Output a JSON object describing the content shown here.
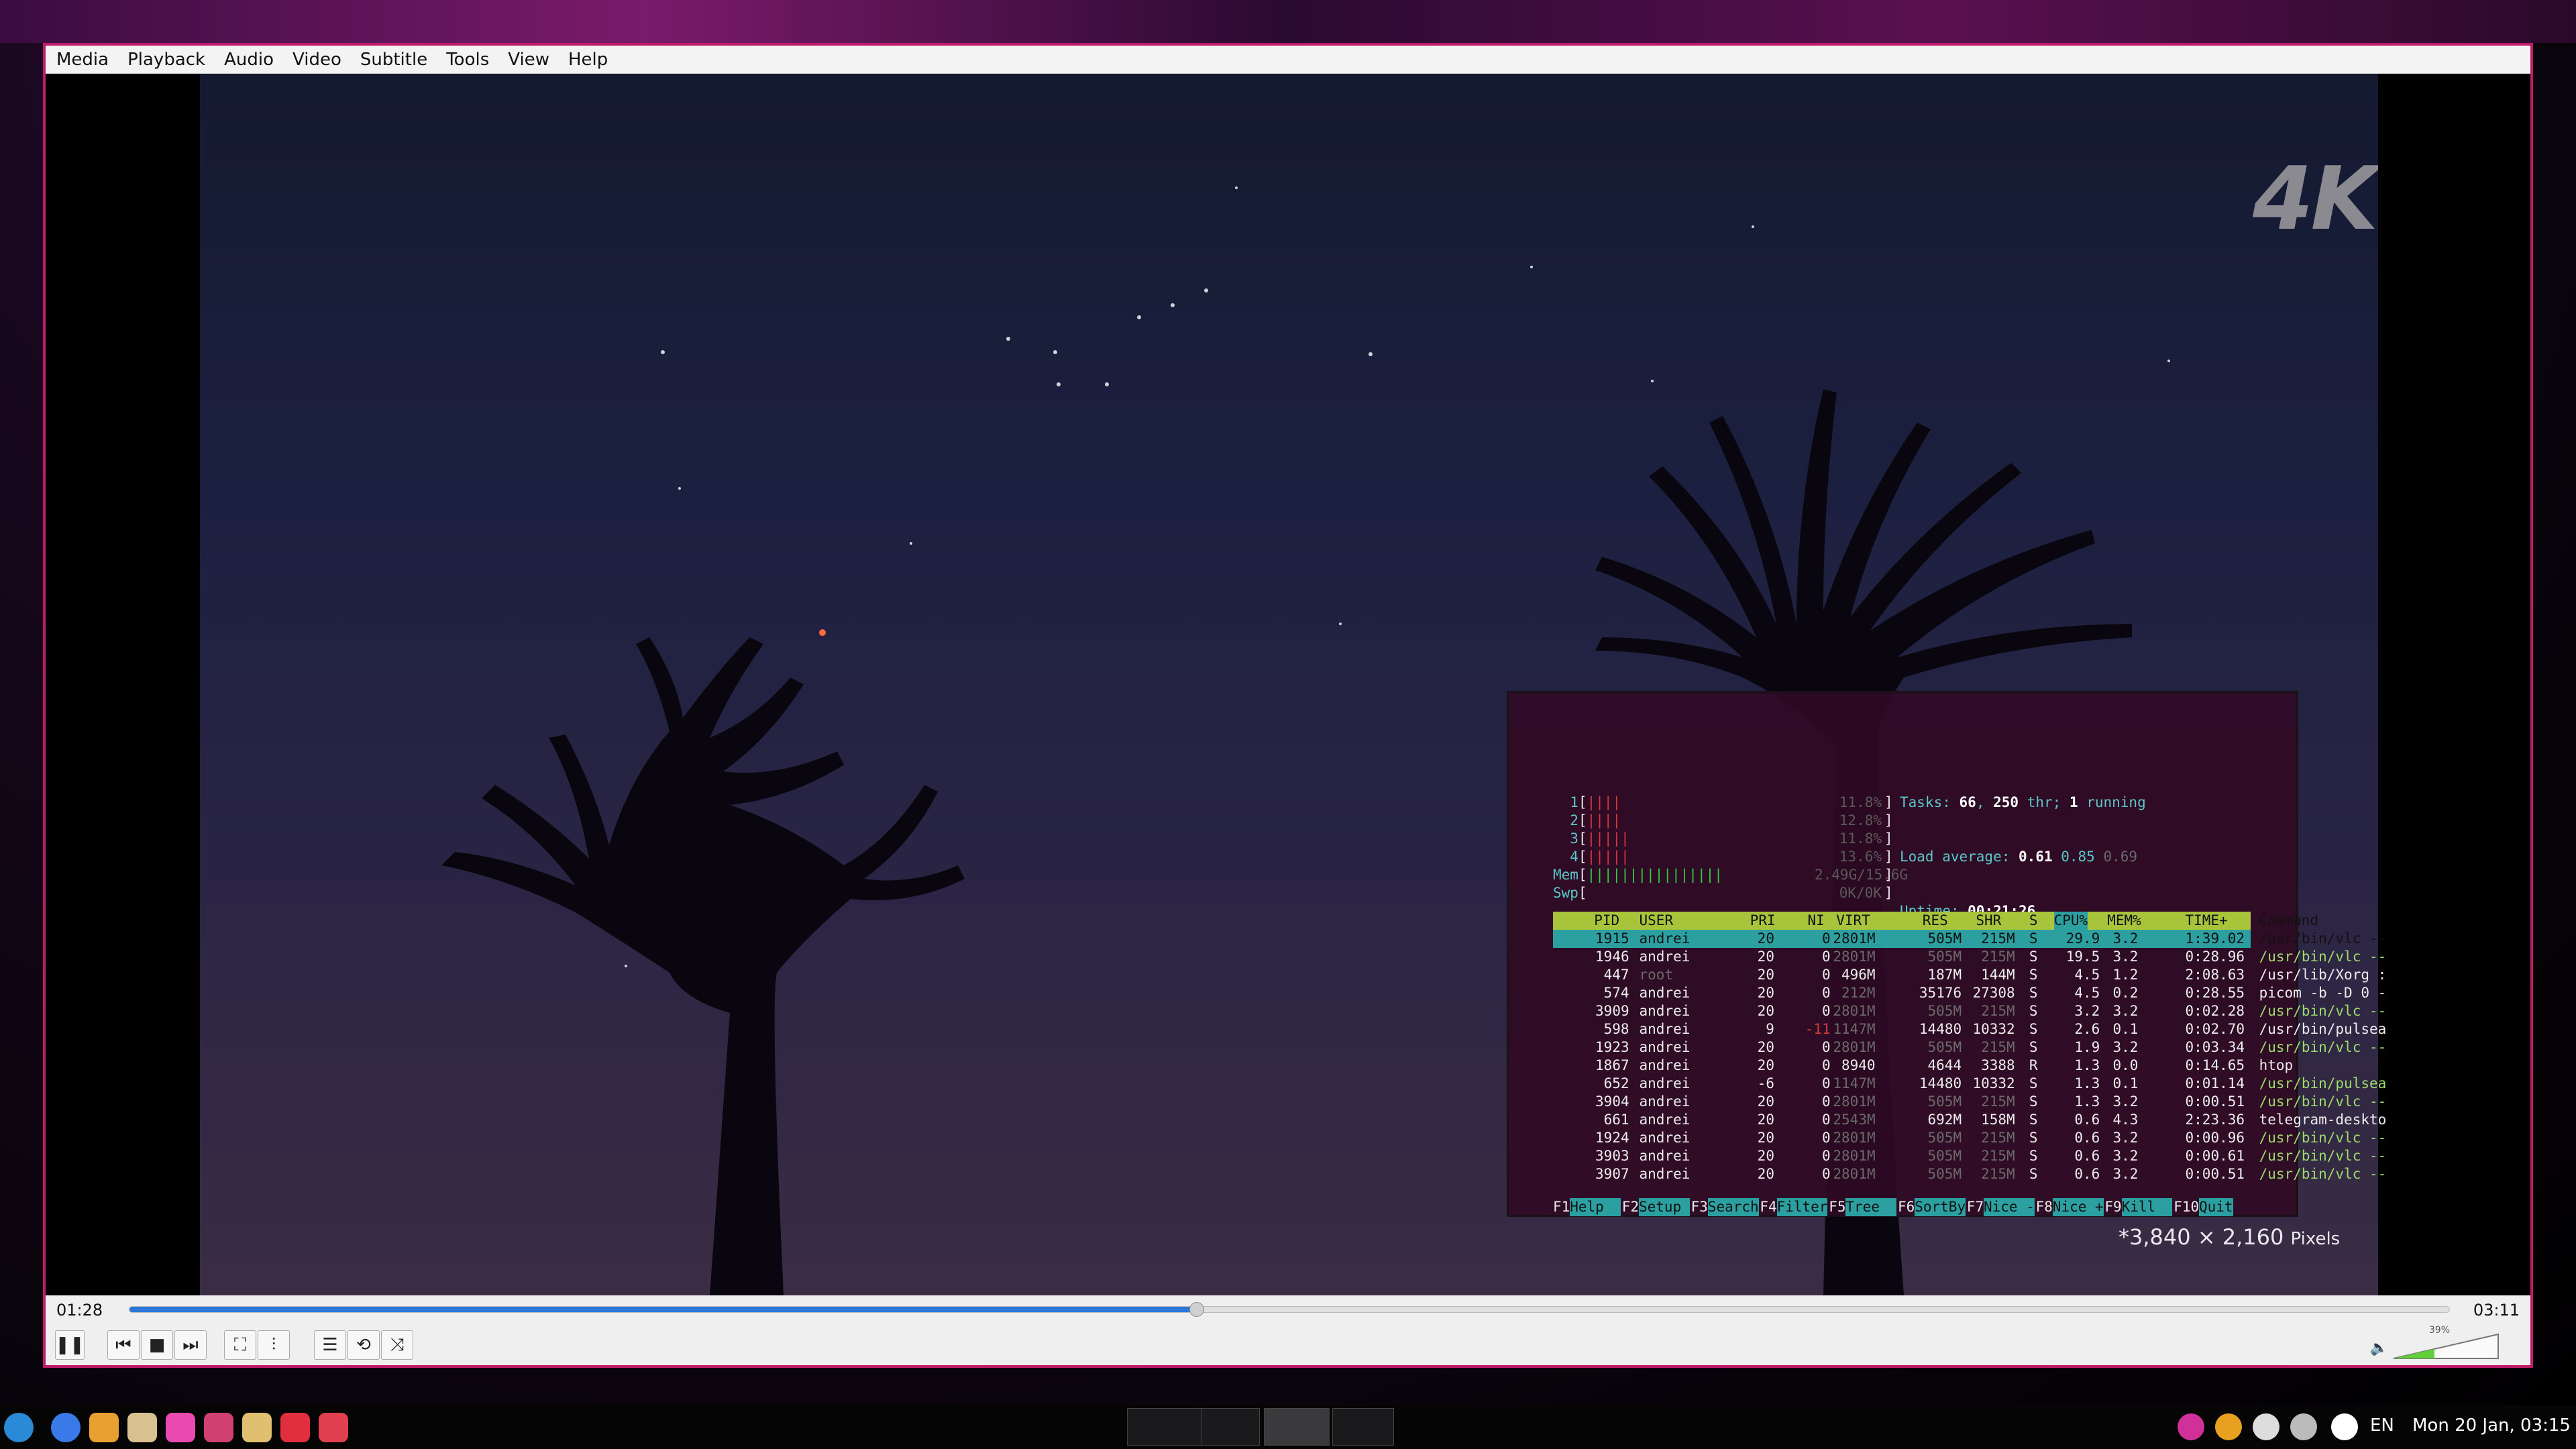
{
  "window": {
    "menus": [
      "Media",
      "Playback",
      "Audio",
      "Video",
      "Subtitle",
      "Tools",
      "View",
      "Help"
    ],
    "video": {
      "watermark": "4K",
      "resolution_text": "*3,840 × 2,160",
      "resolution_unit": "Pixels"
    }
  },
  "htop": {
    "cpus": [
      {
        "label": "1",
        "bars": "||||",
        "value": "11.8%"
      },
      {
        "label": "2",
        "bars": "||||",
        "value": "12.8%"
      },
      {
        "label": "3",
        "bars": "|||||",
        "value": "11.8%"
      },
      {
        "label": "4",
        "bars": "|||||",
        "value": "13.6%"
      }
    ],
    "mem": {
      "label": "Mem",
      "bars": "||||||||||||||||",
      "value": "2.49G/15.6G"
    },
    "swp": {
      "label": "Swp",
      "bars": "",
      "value": "0K/0K"
    },
    "tasks_label": "Tasks: ",
    "tasks": "66",
    "thr": "250",
    "thr_label": " thr; ",
    "running": "1",
    "running_label": " running",
    "load_label": "Load average: ",
    "load1": "0.61",
    "load5": "0.85",
    "load15": "0.69",
    "uptime_label": "Uptime: ",
    "uptime": "00:21:26",
    "columns": [
      "PID",
      "USER",
      "PRI",
      "NI",
      "VIRT",
      "RES",
      "SHR",
      "S",
      "CPU%",
      "MEM%",
      "TIME+",
      "Command"
    ],
    "rows": [
      [
        "1915",
        "andrei",
        "20",
        "0",
        "2801M",
        "505M",
        "215M",
        "S",
        "29.9",
        "3.2",
        "1:39.02",
        "/usr/bin/vlc --"
      ],
      [
        "1946",
        "andrei",
        "20",
        "0",
        "2801M",
        "505M",
        "215M",
        "S",
        "19.5",
        "3.2",
        "0:28.96",
        "/usr/bin/vlc --"
      ],
      [
        "447",
        "root",
        "20",
        "0",
        "496M",
        "187M",
        "144M",
        "S",
        "4.5",
        "1.2",
        "2:08.63",
        "/usr/lib/Xorg :"
      ],
      [
        "574",
        "andrei",
        "20",
        "0",
        "212M",
        "35176",
        "27308",
        "S",
        "4.5",
        "0.2",
        "0:28.55",
        "picom -b -D 0 -"
      ],
      [
        "3909",
        "andrei",
        "20",
        "0",
        "2801M",
        "505M",
        "215M",
        "S",
        "3.2",
        "3.2",
        "0:02.28",
        "/usr/bin/vlc --"
      ],
      [
        "598",
        "andrei",
        "9",
        "-11",
        "1147M",
        "14480",
        "10332",
        "S",
        "2.6",
        "0.1",
        "0:02.70",
        "/usr/bin/pulsea"
      ],
      [
        "1923",
        "andrei",
        "20",
        "0",
        "2801M",
        "505M",
        "215M",
        "S",
        "1.9",
        "3.2",
        "0:03.34",
        "/usr/bin/vlc --"
      ],
      [
        "1867",
        "andrei",
        "20",
        "0",
        "8940",
        "4644",
        "3388",
        "R",
        "1.3",
        "0.0",
        "0:14.65",
        "htop"
      ],
      [
        "652",
        "andrei",
        "-6",
        "0",
        "1147M",
        "14480",
        "10332",
        "S",
        "1.3",
        "0.1",
        "0:01.14",
        "/usr/bin/pulsea"
      ],
      [
        "3904",
        "andrei",
        "20",
        "0",
        "2801M",
        "505M",
        "215M",
        "S",
        "1.3",
        "3.2",
        "0:00.51",
        "/usr/bin/vlc --"
      ],
      [
        "661",
        "andrei",
        "20",
        "0",
        "2543M",
        "692M",
        "158M",
        "S",
        "0.6",
        "4.3",
        "2:23.36",
        "telegram-deskto"
      ],
      [
        "1924",
        "andrei",
        "20",
        "0",
        "2801M",
        "505M",
        "215M",
        "S",
        "0.6",
        "3.2",
        "0:00.96",
        "/usr/bin/vlc --"
      ],
      [
        "3903",
        "andrei",
        "20",
        "0",
        "2801M",
        "505M",
        "215M",
        "S",
        "0.6",
        "3.2",
        "0:00.61",
        "/usr/bin/vlc --"
      ],
      [
        "3907",
        "andrei",
        "20",
        "0",
        "2801M",
        "505M",
        "215M",
        "S",
        "0.6",
        "3.2",
        "0:00.51",
        "/usr/bin/vlc --"
      ]
    ],
    "fkeys": [
      {
        "key": "F1",
        "label": "Help  "
      },
      {
        "key": "F2",
        "label": "Setup "
      },
      {
        "key": "F3",
        "label": "Search"
      },
      {
        "key": "F4",
        "label": "Filter"
      },
      {
        "key": "F5",
        "label": "Tree  "
      },
      {
        "key": "F6",
        "label": "SortBy"
      },
      {
        "key": "F7",
        "label": "Nice -"
      },
      {
        "key": "F8",
        "label": "Nice +"
      },
      {
        "key": "F9",
        "label": "Kill  "
      },
      {
        "key": "F10",
        "label": "Quit"
      }
    ]
  },
  "controls": {
    "time_elapsed": "01:28",
    "time_total": "03:11",
    "progress": 0.46,
    "volume_label": "39%",
    "volume": 0.39
  },
  "taskbar": {
    "language": "EN",
    "clock": "Mon 20 Jan, 03:15",
    "launcher_icons": [
      "start-menu-icon",
      "chromium-icon",
      "files-icon",
      "calculator-icon",
      "app-icon",
      "app-icon",
      "app-icon",
      "app-icon",
      "app-icon"
    ],
    "colors": {
      "accent": "#c01a6a",
      "progress": "#2a78d8",
      "htop_header": "#a8c43a",
      "htop_select": "#2ca0a0"
    }
  }
}
